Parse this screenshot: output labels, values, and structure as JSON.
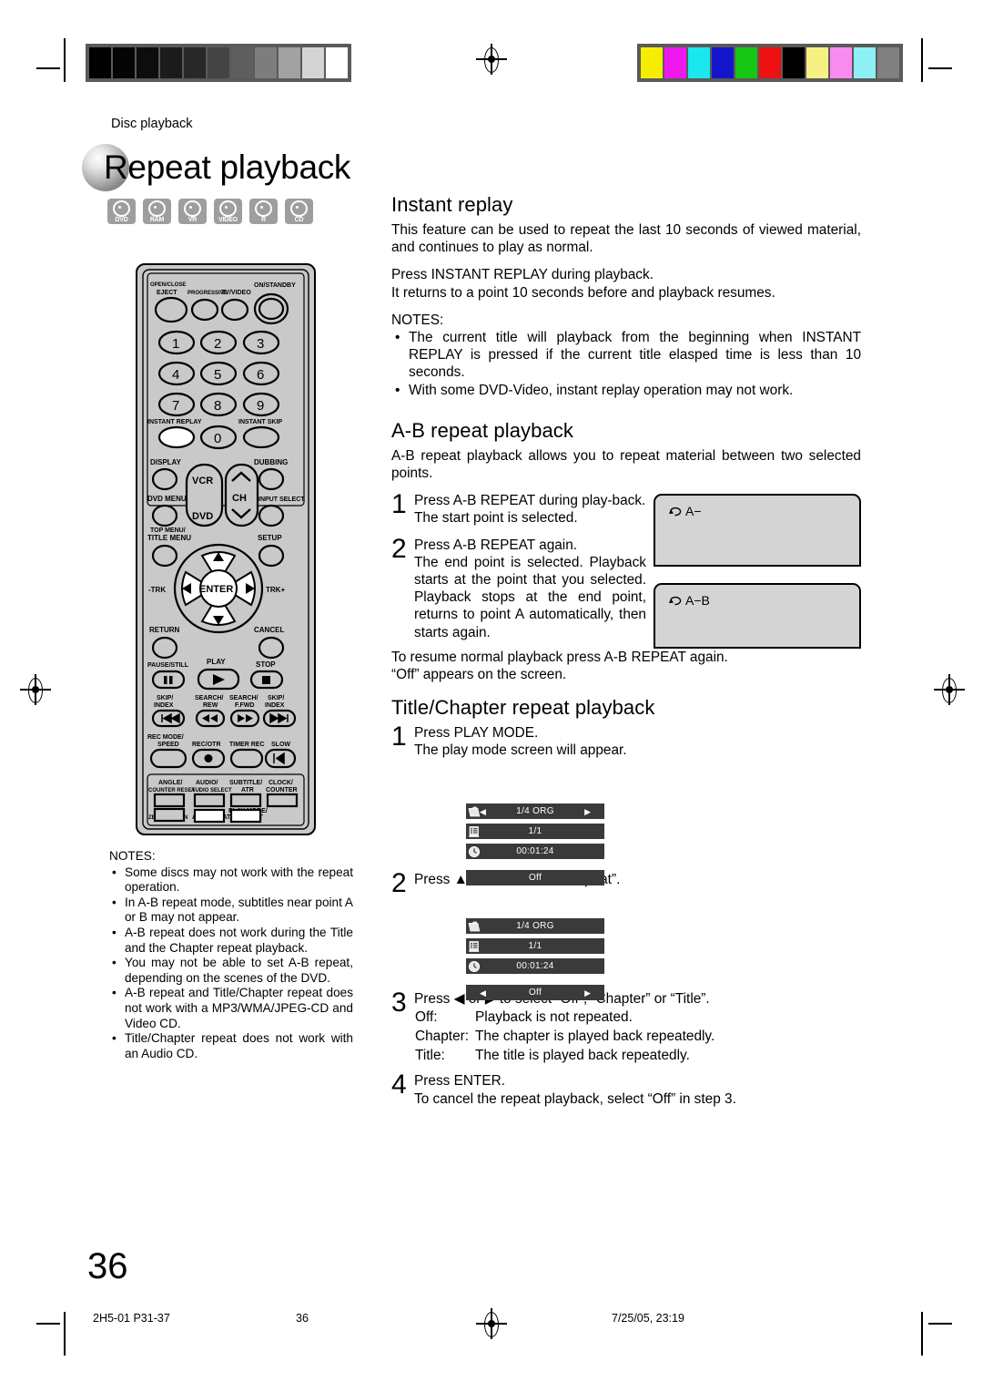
{
  "running_head": "Disc playback",
  "page_title": "Repeat playback",
  "disc_badges": [
    {
      "label": "DVD"
    },
    {
      "label": "RAM"
    },
    {
      "label": "VR"
    },
    {
      "label": "VIDEO"
    },
    {
      "label": "R"
    },
    {
      "label": "CD"
    }
  ],
  "remote": {
    "top_buttons": [
      {
        "label_top": "OPEN/CLOSE",
        "label": "EJECT"
      },
      {
        "label_top": "",
        "label": "PROGRESSIVE"
      },
      {
        "label_top": "",
        "label": "TV/VIDEO"
      },
      {
        "label_top": "",
        "label": "ON/STANDBY"
      }
    ],
    "keypad": [
      "1",
      "2",
      "3",
      "4",
      "5",
      "6",
      "7",
      "8",
      "9",
      "0"
    ],
    "instant_replay": "INSTANT REPLAY",
    "instant_skip": "INSTANT SKIP",
    "display": "DISPLAY",
    "dubbing": "DUBBING",
    "dvd_menu": "DVD MENU",
    "input_select": "INPUT SELECT",
    "top_menu": "TOP MENU/",
    "title_menu": "TITLE MENU",
    "setup": "SETUP",
    "vcr": "VCR",
    "dvd": "DVD",
    "ch": "CH",
    "enter": "ENTER",
    "trk_minus": "-TRK",
    "trk_plus": "TRK+",
    "return": "RETURN",
    "cancel": "CANCEL",
    "pause_still": "PAUSE/STILL",
    "play": "PLAY",
    "stop": "STOP",
    "skip_index_l1": "SKIP/",
    "skip_index_l2": "INDEX",
    "search_rew_l1": "SEARCH/",
    "search_rew_l2": "REW",
    "search_ffwd_l1": "SEARCH/",
    "search_ffwd_l2": "F.FWD",
    "rec_mode_l1": "REC MODE/",
    "rec_mode_l2": "SPEED",
    "rec_otr": "REC/OTR",
    "timer_rec": "TIMER REC",
    "slow": "SLOW",
    "angle_l1": "ANGLE/",
    "angle_l2": "COUNTER RESET",
    "audio_l1": "AUDIO/",
    "audio_l2": "AUDIO SELECT",
    "subtitle_l1": "SUBTITLE/",
    "subtitle_l2": "ATR",
    "clock_l1": "CLOCK/",
    "clock_l2": "COUNTER",
    "zoom_l1": "ZOOM/",
    "zoom_l2": "ZERO RETURN",
    "ab_repeat": "A-B REPEAT",
    "play_mode_l1": "PLAY MODE/",
    "play_mode_l2": "REPEAT"
  },
  "left_notes": {
    "heading": "NOTES:",
    "items": [
      "Some discs may not work with the repeat operation.",
      "In A-B repeat mode, subtitles near point A or B may not appear.",
      "A-B repeat does not work during the Title and the Chapter repeat playback.",
      "You may not be able to set A-B repeat, depending on the scenes of the DVD.",
      "A-B repeat and Title/Chapter repeat does not work with a MP3/WMA/JPEG-CD and Video CD.",
      "Title/Chapter repeat does not work with an Audio CD."
    ]
  },
  "instant_replay": {
    "heading": "Instant replay",
    "para1": "This feature can be used to repeat the last 10 seconds of viewed material, and continues to play as normal.",
    "para2_line1": "Press INSTANT REPLAY during playback.",
    "para2_line2": "It returns to a point 10 seconds before and playback resumes.",
    "notes_heading": "NOTES:",
    "notes": [
      "The current title will playback from the beginning when INSTANT REPLAY is pressed if the current title elasped time is less than 10 seconds.",
      "With some DVD-Video, instant replay operation may not work."
    ]
  },
  "ab_repeat": {
    "heading": "A-B repeat playback",
    "intro": "A-B repeat playback allows you to repeat material between two selected points.",
    "steps": [
      {
        "num": "1",
        "lines": [
          "Press A-B REPEAT during play-back.",
          "The start point is selected."
        ],
        "screen_label": "A−"
      },
      {
        "num": "2",
        "lines": [
          "Press A-B REPEAT again.",
          "The end point is selected. Playback starts at the point that you selected. Playback stops at the end point, returns to point A automatically, then starts again."
        ],
        "screen_label": "A−B"
      }
    ],
    "outro_line1": "To resume normal playback press A-B REPEAT again.",
    "outro_line2": "“Off” appears on the screen."
  },
  "title_chapter": {
    "heading": "Title/Chapter repeat playback",
    "step1": {
      "num": "1",
      "line1": "Press PLAY MODE.",
      "line2": "The play mode screen will appear.",
      "osd": {
        "rows": [
          {
            "icon": "folder-icon",
            "text": "1/4 ORG",
            "arrows": true
          },
          {
            "icon": "chapter-icon",
            "text": "1/1",
            "arrows": false
          },
          {
            "icon": "clock-icon",
            "text": "00:01:24",
            "arrows": false
          },
          {
            "icon": "",
            "text": "Off",
            "arrows": false
          }
        ]
      }
    },
    "step2": {
      "num": "2",
      "line1": "Press ▲ or ▼ to select “Repeat”.",
      "osd": {
        "rows": [
          {
            "icon": "folder-icon",
            "text": "1/4 ORG",
            "arrows": false
          },
          {
            "icon": "chapter-icon",
            "text": "1/1",
            "arrows": false
          },
          {
            "icon": "clock-icon",
            "text": "00:01:24",
            "arrows": false
          },
          {
            "icon": "",
            "text": "Off",
            "arrows": true
          }
        ]
      }
    },
    "step3": {
      "num": "3",
      "line1": "Press ◀ or ▶ to select “Off”, “Chapter” or “Title”.",
      "defs": [
        {
          "term": "Off:",
          "desc": "Playback is not repeated."
        },
        {
          "term": "Chapter:",
          "desc": "The chapter is played back repeatedly."
        },
        {
          "term": "Title:",
          "desc": "The title is played back repeatedly."
        }
      ]
    },
    "step4": {
      "num": "4",
      "line1": "Press ENTER.",
      "line2": "To cancel the repeat playback, select “Off” in step 3."
    }
  },
  "page_number": "36",
  "footer": {
    "left": "2H5-01 P31-37",
    "center": "36",
    "right": "7/25/05, 23:19"
  },
  "calibration": {
    "gray_patches": [
      "#000000",
      "#050505",
      "#0d0d0d",
      "#1b1b1b",
      "#282828",
      "#444444",
      "#5e5e5e",
      "#7d7d7d",
      "#a2a2a2",
      "#d4d4d4",
      "#ffffff"
    ],
    "color_patches": [
      "#f5ee00",
      "#ee19ee",
      "#19e8ee",
      "#1515cc",
      "#16c716",
      "#ee1111",
      "#000000",
      "#f7f083",
      "#f98cf0",
      "#8cf0f5",
      "#808080"
    ]
  }
}
